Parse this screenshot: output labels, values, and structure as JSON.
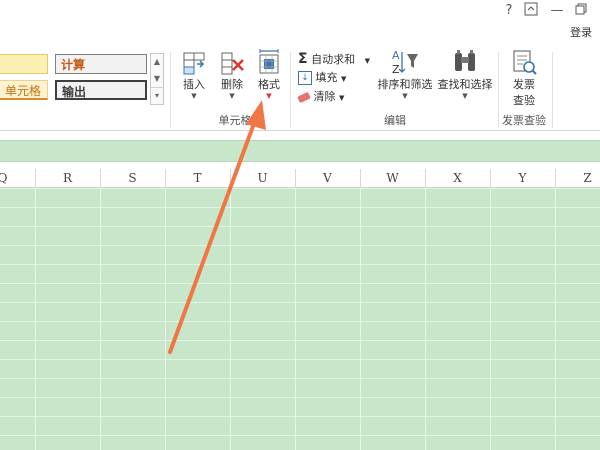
{
  "window": {
    "help_icon": "?",
    "ribbon_display_icon": "ribbon-display-options-icon",
    "minimize_icon": "—",
    "restore_icon": "restore-icon",
    "login_label": "登录"
  },
  "ribbon": {
    "styles": {
      "left_top": "",
      "left_bottom": "单元格",
      "calc": "计算",
      "output": "输出"
    },
    "cells_group": {
      "insert": "插入",
      "delete": "删除",
      "format": "格式",
      "label": "单元格"
    },
    "editing_group": {
      "autosum": "自动求和",
      "fill": "填充",
      "clear": "清除",
      "sort_filter": "排序和筛选",
      "find_select": "查找和选择",
      "label": "编辑"
    },
    "invoice_group": {
      "check_line1": "发票",
      "check_line2": "查验",
      "label": "发票查验"
    }
  },
  "sheet": {
    "columns": [
      "Q",
      "R",
      "S",
      "T",
      "U",
      "V",
      "W",
      "X",
      "Y",
      "Z"
    ],
    "fill_color": "#c8e6c9"
  },
  "colors": {
    "arrow": "#f07745",
    "accent_orange": "#c65911"
  }
}
